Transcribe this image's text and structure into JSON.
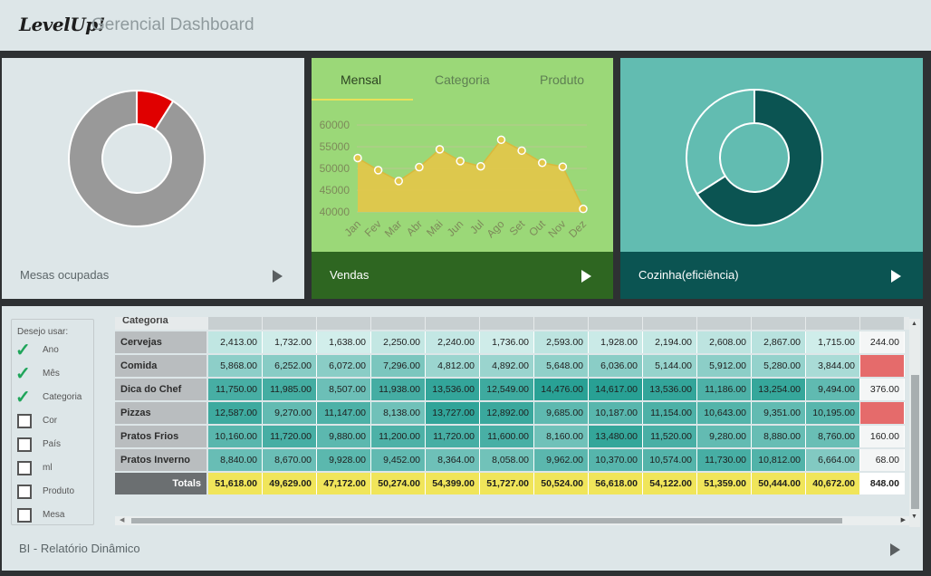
{
  "header": {
    "logo": "LevelUp!",
    "title": "Gerencial Dashboard"
  },
  "cards": [
    {
      "label": "Mesas ocupadas",
      "donut": {
        "fraction_highlight": 0.09,
        "color_highlight": "#e00000",
        "color_rest": "#999999"
      }
    },
    {
      "label": "Vendas",
      "tabs": [
        "Mensal",
        "Categoria",
        "Produto"
      ],
      "active_tab": "Mensal"
    },
    {
      "label": "Cozinha(eficiência)",
      "donut": {
        "fraction_highlight": 0.66,
        "color_highlight": "#0b5452",
        "color_rest": "#62bcb1"
      }
    }
  ],
  "chart_data": {
    "type": "area",
    "categories": [
      "Jan",
      "Fev",
      "Mar",
      "Abr",
      "Mai",
      "Jun",
      "Jul",
      "Ago",
      "Set",
      "Out",
      "Nov",
      "Dez"
    ],
    "values": [
      52400,
      49600,
      47100,
      50300,
      54400,
      51700,
      50500,
      56600,
      54100,
      51300,
      50400,
      40700
    ],
    "ylim": [
      40000,
      60000
    ],
    "yticks": [
      40000,
      45000,
      50000,
      55000,
      60000
    ],
    "title": "",
    "xlabel": "",
    "ylabel": "",
    "fill_color": "#e3c74a",
    "grid": true
  },
  "panel": {
    "footer_label": "BI - Relatório Dinâmico",
    "options_title": "Desejo usar:",
    "options": [
      {
        "label": "Ano",
        "checked": true
      },
      {
        "label": "Mês",
        "checked": true
      },
      {
        "label": "Categoria",
        "checked": true
      },
      {
        "label": "Cor",
        "checked": false
      },
      {
        "label": "País",
        "checked": false
      },
      {
        "label": "ml",
        "checked": false
      },
      {
        "label": "Produto",
        "checked": false
      },
      {
        "label": "Mesa",
        "checked": false
      }
    ],
    "table": {
      "category_header": "Categoria",
      "rows": [
        {
          "label": "Cervejas",
          "values": [
            "2,413.00",
            "1,732.00",
            "1,638.00",
            "2,250.00",
            "2,240.00",
            "1,736.00",
            "2,593.00",
            "1,928.00",
            "2,194.00",
            "2,608.00",
            "2,867.00",
            "1,715.00",
            "244.00"
          ]
        },
        {
          "label": "Comida",
          "values": [
            "5,868.00",
            "6,252.00",
            "6,072.00",
            "7,296.00",
            "4,812.00",
            "4,892.00",
            "5,648.00",
            "6,036.00",
            "5,144.00",
            "5,912.00",
            "5,280.00",
            "3,844.00",
            ""
          ]
        },
        {
          "label": "Dica do Chef",
          "values": [
            "11,750.00",
            "11,985.00",
            "8,507.00",
            "11,938.00",
            "13,536.00",
            "12,549.00",
            "14,476.00",
            "14,617.00",
            "13,536.00",
            "11,186.00",
            "13,254.00",
            "9,494.00",
            "376.00"
          ]
        },
        {
          "label": "Pizzas",
          "values": [
            "12,587.00",
            "9,270.00",
            "11,147.00",
            "8,138.00",
            "13,727.00",
            "12,892.00",
            "9,685.00",
            "10,187.00",
            "11,154.00",
            "10,643.00",
            "9,351.00",
            "10,195.00",
            ""
          ]
        },
        {
          "label": "Pratos Frios",
          "values": [
            "10,160.00",
            "11,720.00",
            "9,880.00",
            "11,200.00",
            "11,720.00",
            "11,600.00",
            "8,160.00",
            "13,480.00",
            "11,520.00",
            "9,280.00",
            "8,880.00",
            "8,760.00",
            "160.00"
          ]
        },
        {
          "label": "Pratos Inverno",
          "values": [
            "8,840.00",
            "8,670.00",
            "9,928.00",
            "9,452.00",
            "8,364.00",
            "8,058.00",
            "9,962.00",
            "10,370.00",
            "10,574.00",
            "11,730.00",
            "10,812.00",
            "6,664.00",
            "68.00"
          ]
        }
      ],
      "totals_label": "Totals",
      "totals": [
        "51,618.00",
        "49,629.00",
        "47,172.00",
        "50,274.00",
        "54,399.00",
        "51,727.00",
        "50,524.00",
        "56,618.00",
        "54,122.00",
        "51,359.00",
        "50,444.00",
        "40,672.00",
        "848.00"
      ]
    }
  }
}
